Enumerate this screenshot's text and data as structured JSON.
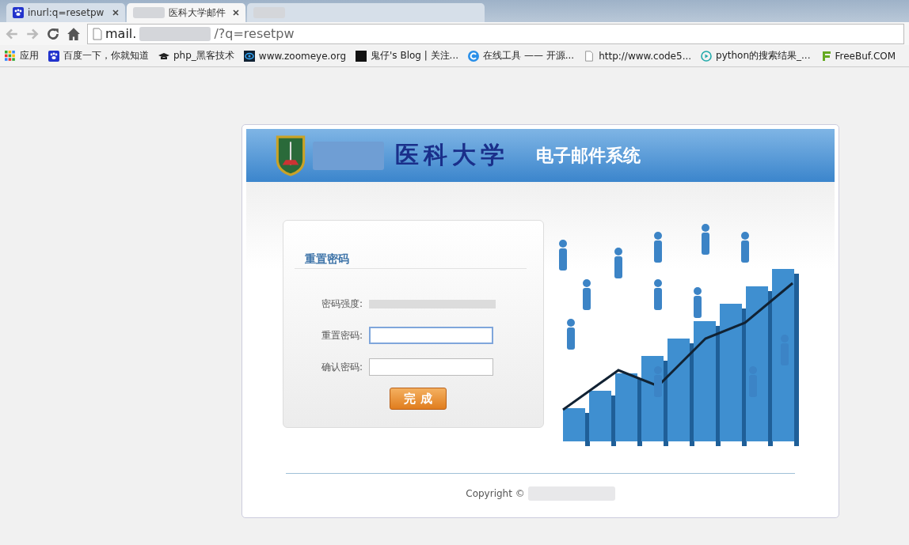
{
  "browser": {
    "tabs": [
      {
        "title": "inurl:q=resetpw",
        "selected": false,
        "kind": "paw"
      },
      {
        "title": "医科大学邮件",
        "selected": true,
        "kind": "blurred"
      },
      {
        "selected": false,
        "kind": "blurred"
      }
    ],
    "address": {
      "prefix": "mail.",
      "suffix": "/?q=resetpw"
    },
    "bookmarks": [
      {
        "label": "应用",
        "kind": "apps"
      },
      {
        "label": "百度一下，你就知道",
        "kind": "paw"
      },
      {
        "label": "php_黑客技术",
        "kind": "hat"
      },
      {
        "label": "www.zoomeye.org",
        "kind": "eye"
      },
      {
        "label": "鬼仔's Blog | 关注...",
        "kind": "gui"
      },
      {
        "label": "在线工具 —— 开源...",
        "kind": "c"
      },
      {
        "label": "http://www.code5...",
        "kind": "page"
      },
      {
        "label": "python的搜索结果_...",
        "kind": "play"
      },
      {
        "label": "FreeBuf.COM",
        "kind": "f"
      }
    ]
  },
  "header": {
    "school": "医科大学",
    "system": "电子邮件系统"
  },
  "form": {
    "title": "重置密码",
    "strength": {
      "label": "密码强度:"
    },
    "fields": [
      {
        "label": "重置密码:",
        "focused": true
      },
      {
        "label": "确认密码:",
        "focused": false
      }
    ],
    "submit": "完 成"
  },
  "footer": {
    "copyright": "Copyright ©"
  }
}
